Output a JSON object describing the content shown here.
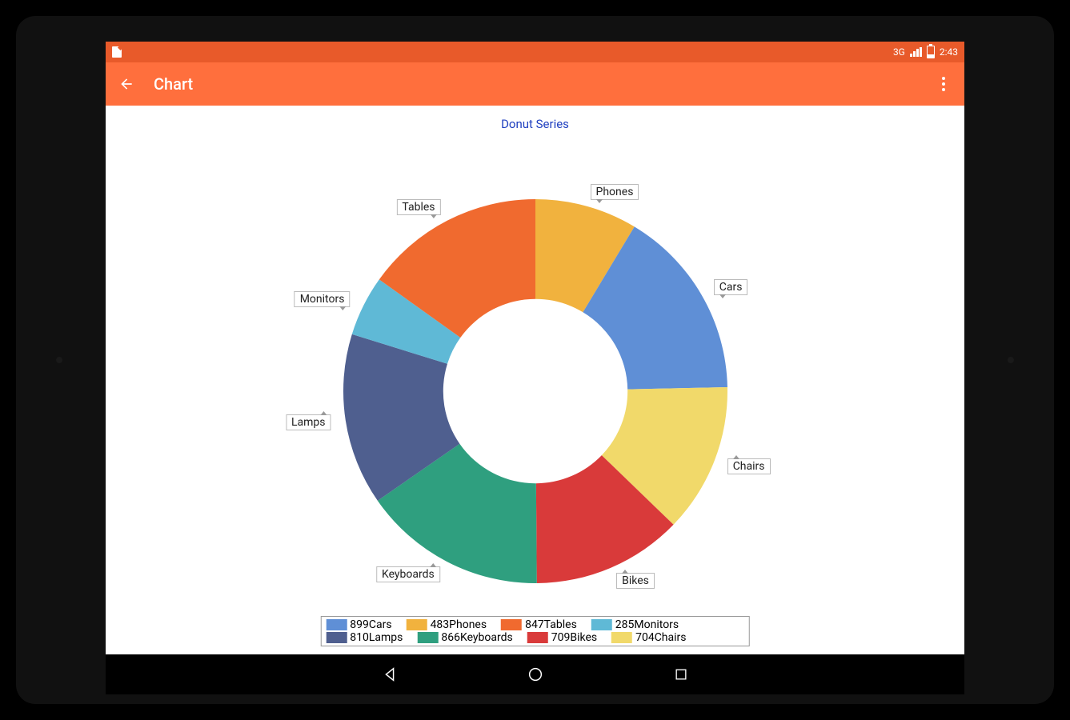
{
  "statusbar": {
    "network_label": "3G",
    "clock": "2:43"
  },
  "appbar": {
    "title": "Chart"
  },
  "chart_data": {
    "type": "pie",
    "title": "Donut Series",
    "series": [
      {
        "name": "Cars",
        "value": 899,
        "color": "#5f8fd6"
      },
      {
        "name": "Phones",
        "value": 483,
        "color": "#f1b23e"
      },
      {
        "name": "Tables",
        "value": 847,
        "color": "#f06a2f"
      },
      {
        "name": "Monitors",
        "value": 285,
        "color": "#5fb9d6"
      },
      {
        "name": "Lamps",
        "value": 810,
        "color": "#4f5f8f"
      },
      {
        "name": "Keyboards",
        "value": 866,
        "color": "#2f9f7f"
      },
      {
        "name": "Bikes",
        "value": 709,
        "color": "#d93a3a"
      },
      {
        "name": "Chairs",
        "value": 704,
        "color": "#f1d96a"
      }
    ],
    "donut_inner_ratio": 0.48,
    "start_angle_deg": -90,
    "direction": "cw_starting_from_phones_boundary"
  },
  "legend": {
    "items": [
      {
        "label": "899Cars",
        "color": "#5f8fd6"
      },
      {
        "label": "483Phones",
        "color": "#f1b23e"
      },
      {
        "label": "847Tables",
        "color": "#f06a2f"
      },
      {
        "label": "285Monitors",
        "color": "#5fb9d6"
      },
      {
        "label": "810Lamps",
        "color": "#4f5f8f"
      },
      {
        "label": "866Keyboards",
        "color": "#2f9f7f"
      },
      {
        "label": "709Bikes",
        "color": "#d93a3a"
      },
      {
        "label": "704Chairs",
        "color": "#f1d96a"
      }
    ]
  }
}
